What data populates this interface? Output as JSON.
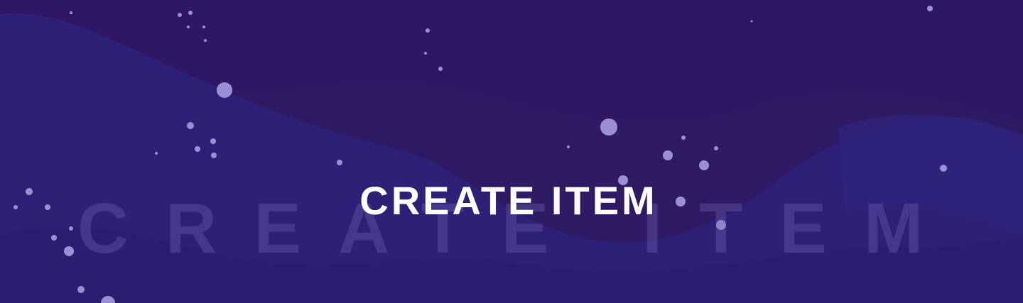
{
  "banner": {
    "title": "CREATE ITEM",
    "watermark": "CREATE ITEM",
    "colors": {
      "background": "#2c1a6a",
      "wave_light": "#2d2278",
      "wave_dark": "#2e1a60",
      "dot": "#9b90d4",
      "title": "#ffffff"
    }
  }
}
